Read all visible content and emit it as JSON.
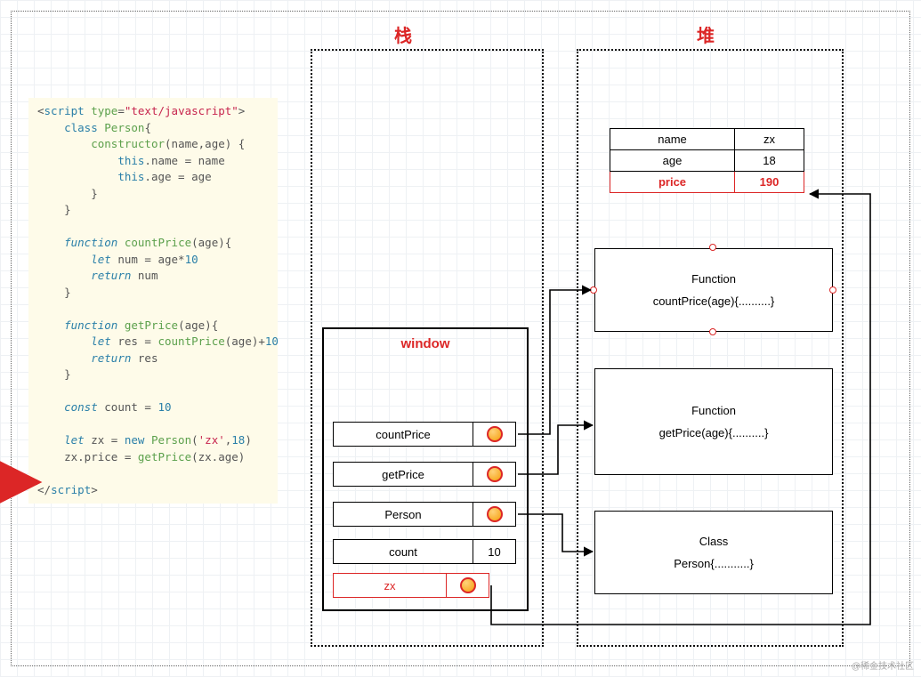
{
  "titles": {
    "stack": "栈",
    "heap": "堆"
  },
  "code": "<script type=\"text/javascript\">\n    class Person{\n        constructor(name,age) {\n            this.name = name\n            this.age = age\n        }\n    }\n\n    function countPrice(age){\n        let num = age*10\n        return num\n    }\n\n    function getPrice(age){\n        let res = countPrice(age)+10\n        return res\n    }\n\n    const count = 10\n\n    let zx = new Person('zx',18)\n    zx.price = getPrice(zx.age)\n\n</script>",
  "code_tokens": {
    "person": "Person",
    "countPrice": "countPrice",
    "getPrice": "getPrice",
    "zx": "zx",
    "count": "count",
    "count_val": "10",
    "zx_str": "'zx'",
    "age_val": "18"
  },
  "window": {
    "title": "window",
    "rows": [
      {
        "label": "countPrice",
        "kind": "ptr"
      },
      {
        "label": "getPrice",
        "kind": "ptr"
      },
      {
        "label": "Person",
        "kind": "ptr"
      },
      {
        "label": "count",
        "kind": "val",
        "value": "10"
      },
      {
        "label": "zx",
        "kind": "ptr",
        "red": true
      }
    ]
  },
  "object": {
    "rows": [
      {
        "k": "name",
        "v": "zx"
      },
      {
        "k": "age",
        "v": "18"
      },
      {
        "k": "price",
        "v": "190",
        "red": true
      }
    ]
  },
  "heap_boxes": [
    {
      "title": "Function",
      "body": "countPrice(age){..........}"
    },
    {
      "title": "Function",
      "body": "getPrice(age){..........}"
    },
    {
      "title": "Class",
      "body": "Person{...........}"
    }
  ],
  "watermark": "@稀金技术社区"
}
